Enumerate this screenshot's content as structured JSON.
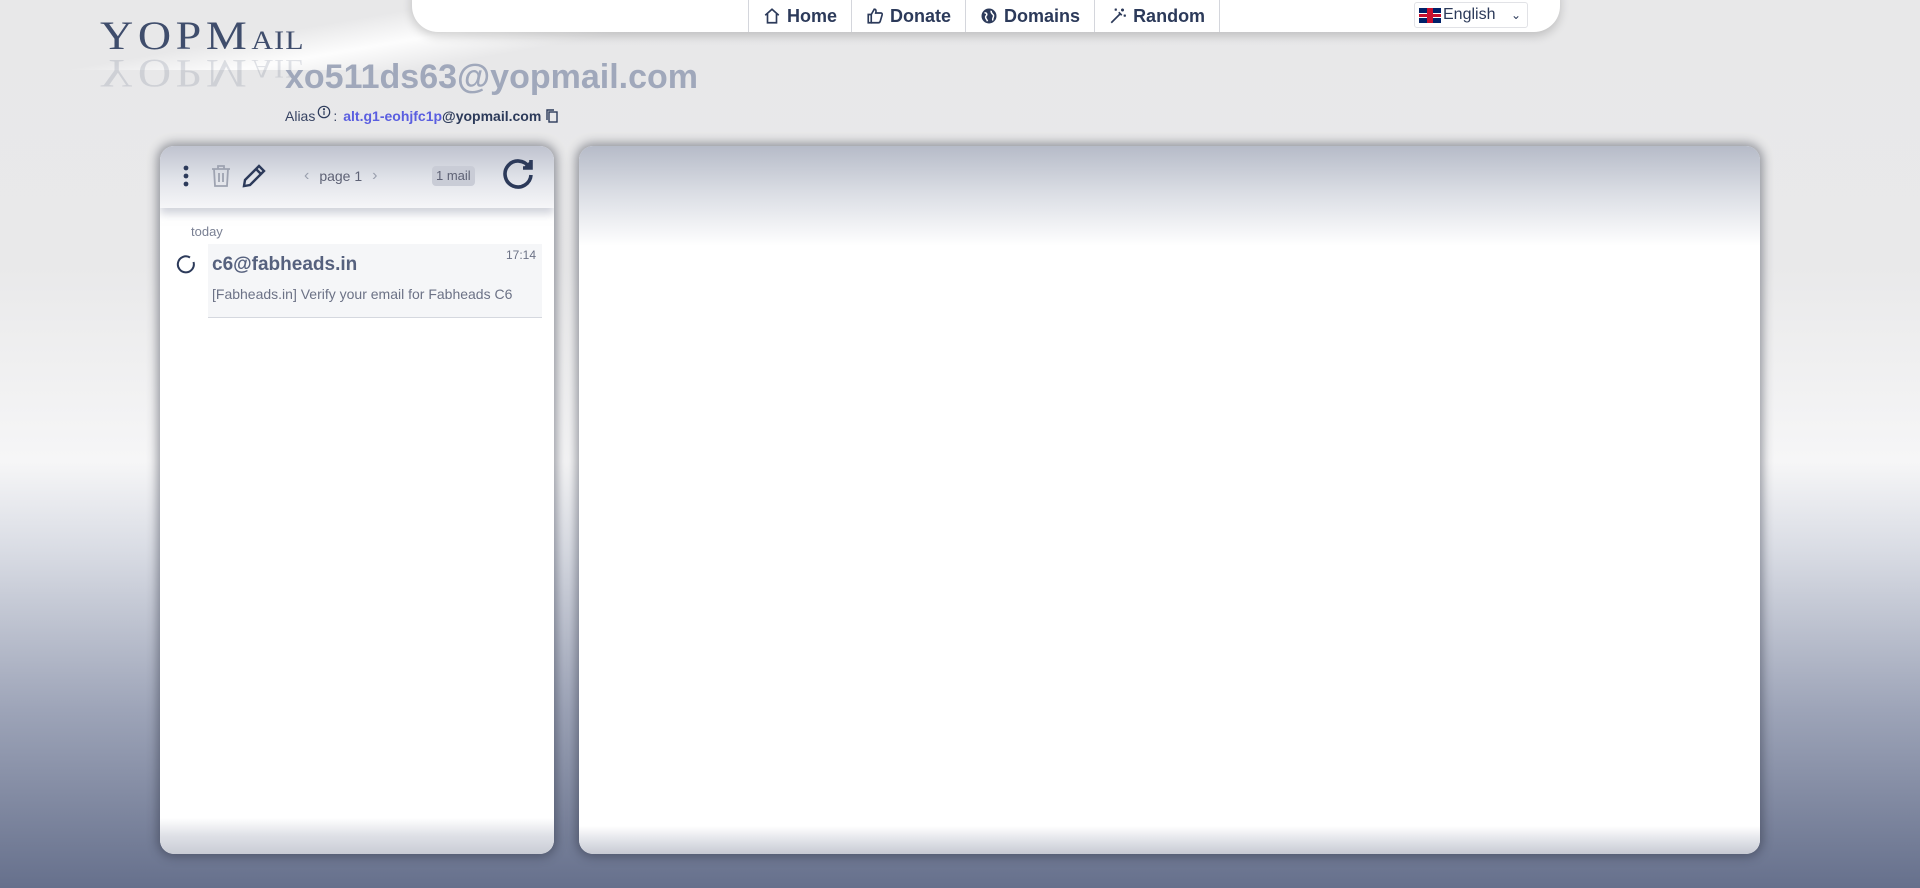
{
  "logo": {
    "big_1": "YOP",
    "big_2": "M",
    "small": "AIL"
  },
  "nav": {
    "items": [
      {
        "label": "Home",
        "icon": "home-icon"
      },
      {
        "label": "Donate",
        "icon": "thumbs-up-icon"
      },
      {
        "label": "Domains",
        "icon": "globe-icon"
      },
      {
        "label": "Random",
        "icon": "magic-wand-icon"
      }
    ],
    "language": "English"
  },
  "inbox": {
    "address": "xo511ds63@yopmail.com",
    "alias_label": "Alias",
    "alias_sep": ":",
    "alias_name": "alt.g1-eohjfc1p",
    "alias_domain": "@yopmail.com"
  },
  "toolbar": {
    "page_label": "page 1",
    "mail_count": "1 mail"
  },
  "mail_list": {
    "group_label": "today",
    "items": [
      {
        "from": "c6@fabheads.in",
        "time": "17:14",
        "subject": "[Fabheads.in] Verify your email for Fabheads C6"
      }
    ]
  },
  "colors": {
    "brand": "#2c3a5a",
    "alias_link": "#5a5ee0",
    "address": "#a0a8bb"
  }
}
